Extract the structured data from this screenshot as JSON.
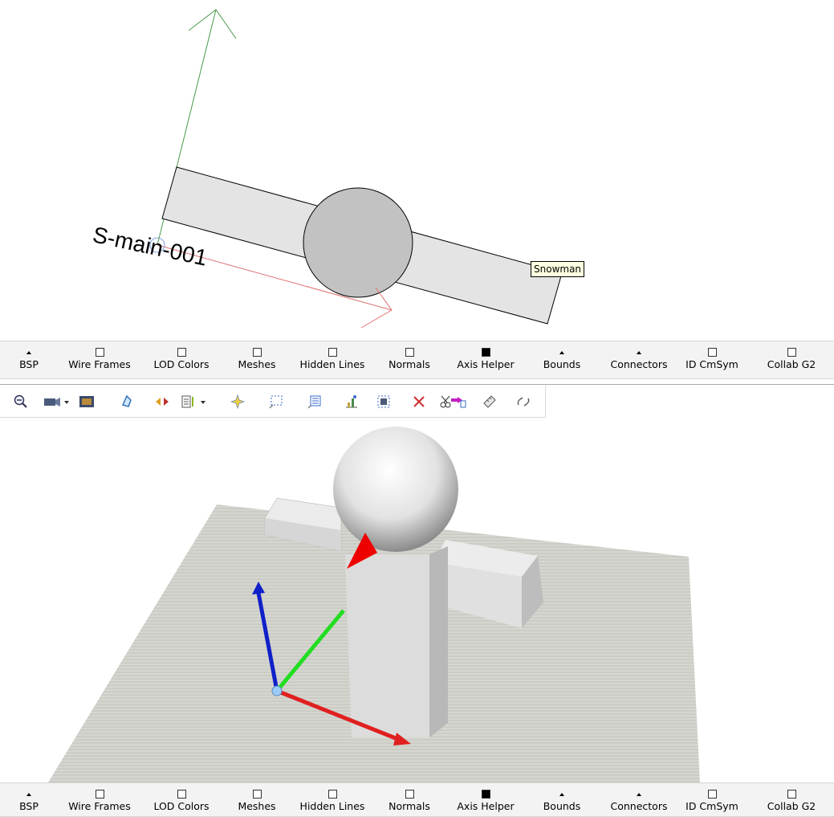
{
  "top_view": {
    "object_label": "S-main-001",
    "tooltip": "Snowman"
  },
  "display_options": [
    {
      "label": "BSP",
      "state": "triangle"
    },
    {
      "label": "Wire Frames",
      "state": "unchecked"
    },
    {
      "label": "LOD Colors",
      "state": "unchecked"
    },
    {
      "label": "Meshes",
      "state": "unchecked"
    },
    {
      "label": "Hidden Lines",
      "state": "unchecked"
    },
    {
      "label": "Normals",
      "state": "unchecked"
    },
    {
      "label": "Axis Helper",
      "state": "checked"
    },
    {
      "label": "Bounds",
      "state": "triangle"
    },
    {
      "label": "Connectors",
      "state": "triangle"
    },
    {
      "label": "ID CmSym",
      "state": "unchecked"
    },
    {
      "label": "Collab G2",
      "state": "unchecked"
    }
  ],
  "toolbar_icons": [
    "zoom-out-icon",
    "camera-dropdown-icon",
    "render-image-icon",
    "select-shape-icon",
    "horizontal-flip-icon",
    "layers-dropdown-icon",
    "sparkle-add-icon",
    "select-rectangle-icon",
    "list-edit-icon",
    "graph-icon",
    "fit-view-icon",
    "delete-icon",
    "cut-paste-icon",
    "ruler-icon",
    "link-break-icon"
  ],
  "colors": {
    "axis_x": "#e02020",
    "axis_y": "#20d020",
    "axis_z": "#1020d0",
    "nose": "#ee0000",
    "tooltip_bg": "#ffffe1"
  }
}
